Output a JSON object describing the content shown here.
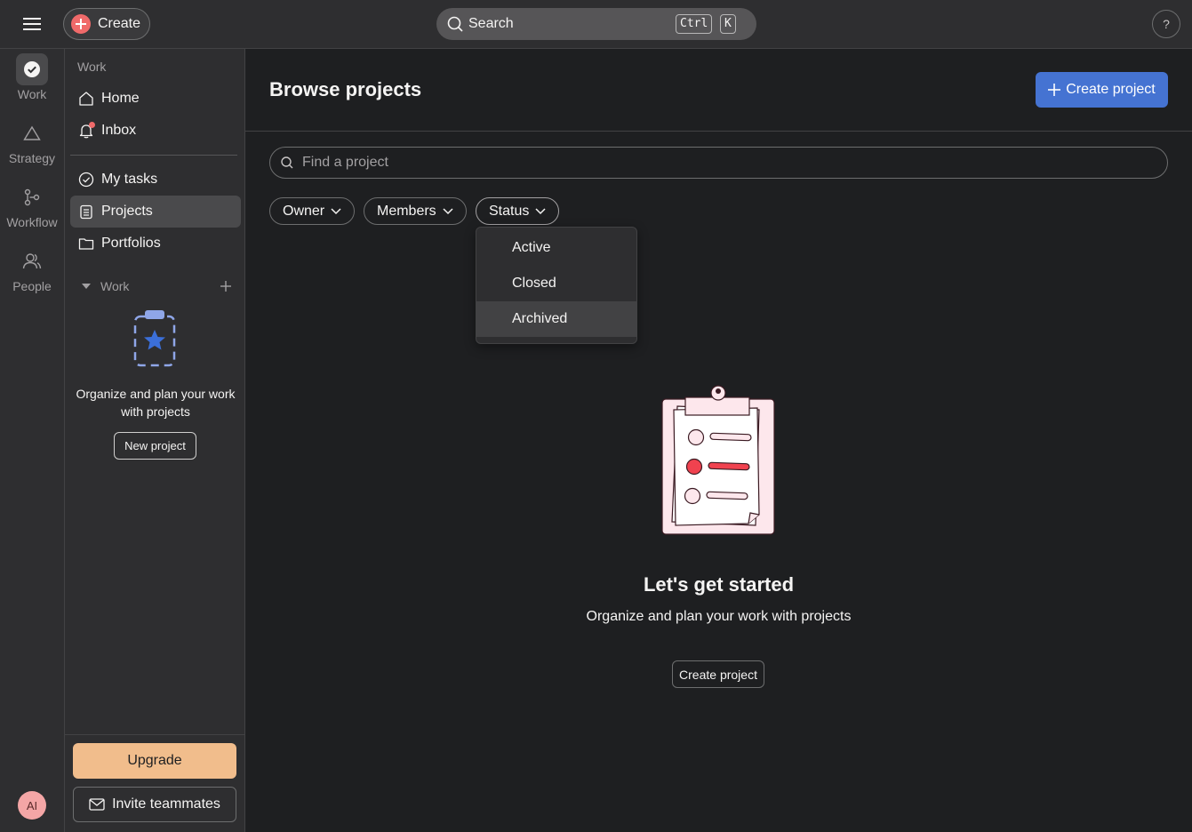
{
  "topbar": {
    "create_label": "Create",
    "search_label": "Search",
    "shortcut_keys": [
      "Ctrl",
      "K"
    ],
    "help_label": "?"
  },
  "rail": {
    "items": [
      {
        "label": "Work",
        "icon": "check-circle-icon"
      },
      {
        "label": "Strategy",
        "icon": "triangle-icon"
      },
      {
        "label": "Workflow",
        "icon": "workflow-icon"
      },
      {
        "label": "People",
        "icon": "people-icon"
      }
    ],
    "avatar_initials": "AI"
  },
  "sidebar": {
    "heading": "Work",
    "items": [
      {
        "label": "Home",
        "icon": "home-icon"
      },
      {
        "label": "Inbox",
        "icon": "bell-icon"
      },
      {
        "label": "My tasks",
        "icon": "check-circle-icon"
      },
      {
        "label": "Projects",
        "icon": "clipboard-icon"
      },
      {
        "label": "Portfolios",
        "icon": "folder-icon"
      }
    ],
    "section_label": "Work",
    "empty_text": "Organize and plan your work with projects",
    "new_project_label": "New project",
    "upgrade_label": "Upgrade",
    "invite_label": "Invite teammates"
  },
  "main": {
    "title": "Browse projects",
    "create_project_label": "Create project",
    "find_placeholder": "Find a project",
    "filters": [
      "Owner",
      "Members",
      "Status"
    ],
    "status_options": [
      "Active",
      "Closed",
      "Archived"
    ],
    "empty_title": "Let's get started",
    "empty_subtitle": "Organize and plan your work with projects",
    "empty_button": "Create project"
  },
  "colors": {
    "accent": "#4573d2",
    "create_plus": "#f06a6a",
    "upgrade": "#f1bd8c",
    "background": "#1e1f21",
    "panel": "#2e2e30"
  }
}
